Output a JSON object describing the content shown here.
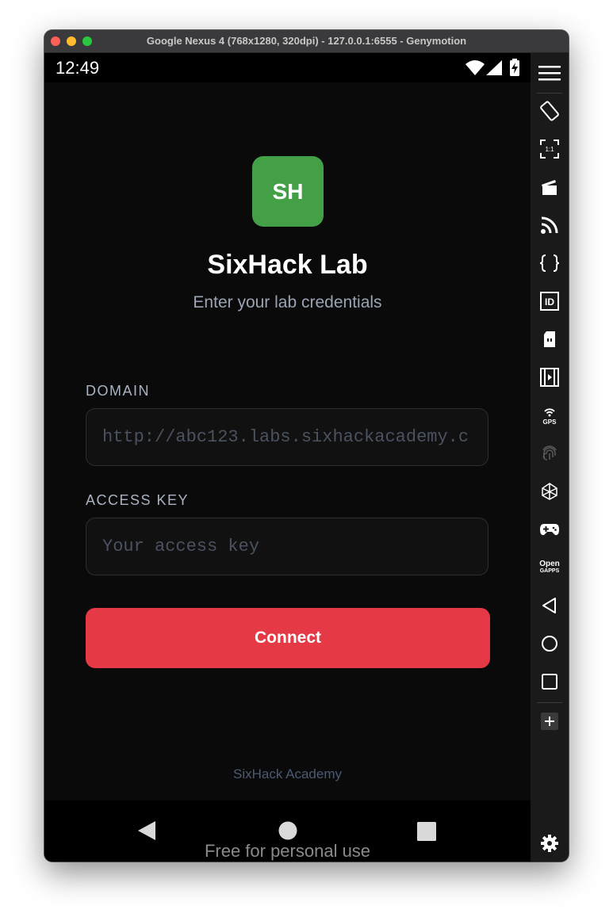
{
  "window": {
    "title": "Google Nexus 4 (768x1280, 320dpi) - 127.0.0.1:6555 - Genymotion"
  },
  "statusbar": {
    "time": "12:49",
    "icons": [
      "wifi-icon",
      "signal-icon",
      "battery-charging-icon"
    ]
  },
  "app": {
    "logo_text": "SH",
    "logo_color": "#43a047",
    "title": "SixHack Lab",
    "subtitle": "Enter your lab credentials",
    "domain": {
      "label": "DOMAIN",
      "value": "",
      "placeholder": "http://abc123.labs.sixhackacademy.c"
    },
    "access_key": {
      "label": "ACCESS KEY",
      "value": "",
      "placeholder": "Your access key"
    },
    "connect_label": "Connect",
    "connect_color": "#e63946",
    "footer": "SixHack Academy"
  },
  "navbar": {
    "buttons": [
      "back-icon",
      "home-icon",
      "recents-icon"
    ],
    "watermark": "Free for personal use"
  },
  "sidebar": {
    "items": [
      "menu-icon",
      "rotate-icon",
      "pixel-perfect-icon",
      "capture-icon",
      "cast-icon",
      "code-icon",
      "id-icon",
      "sd-card-icon",
      "video-icon",
      "gps-icon",
      "fingerprint-icon",
      "motion-sensor-icon",
      "gamepad-icon",
      "opengapps-icon",
      "back-icon",
      "home-icon",
      "recents-icon",
      "add-icon",
      "settings-icon"
    ],
    "scale_label": "1:1",
    "id_label": "ID",
    "gps_label": "GPS",
    "opengapps_label_line1": "Open",
    "opengapps_label_line2": "GAPPS"
  }
}
